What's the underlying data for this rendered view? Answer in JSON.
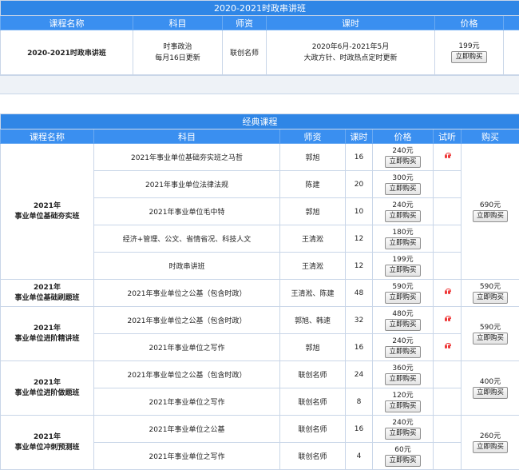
{
  "top": {
    "title": "2020-2021时政串讲班",
    "headers": [
      "课程名称",
      "科目",
      "师资",
      "课时",
      "价格"
    ],
    "row": {
      "name": "2020-2021时政串讲班",
      "subject_line1": "时事政治",
      "subject_line2": "每月16日更新",
      "teacher": "联创名师",
      "hours_line1": "2020年6月-2021年5月",
      "hours_line2": "大政方针、时政热点定时更新",
      "price": "199元",
      "buy": "立即购买"
    }
  },
  "classic": {
    "title": "经典课程",
    "headers": [
      "课程名称",
      "科目",
      "师资",
      "课时",
      "价格",
      "试听",
      "购买"
    ],
    "buy_label": "立即购买",
    "groups": [
      {
        "name_line1": "2021年",
        "name_line2": "事业单位基础夯实班",
        "package_price": "690元",
        "rows": [
          {
            "subject": "2021年事业单位基础夯实班之马哲",
            "teacher": "郭旭",
            "hours": "16",
            "price": "240元"
          },
          {
            "subject": "2021年事业单位法律法规",
            "teacher": "陈建",
            "hours": "20",
            "price": "300元"
          },
          {
            "subject": "2021年事业单位毛中特",
            "teacher": "郭旭",
            "hours": "10",
            "price": "240元"
          },
          {
            "subject": "经济+管理、公文、省情省况、科技人文",
            "teacher": "王清淞",
            "hours": "12",
            "price": "180元"
          },
          {
            "subject": "时政串讲班",
            "teacher": "王清淞",
            "hours": "12",
            "price": "199元"
          }
        ]
      },
      {
        "name_line1": "2021年",
        "name_line2": "事业单位基础刷题班",
        "package_price": "590元",
        "rows": [
          {
            "subject": "2021年事业单位之公基（包含时政）",
            "teacher": "王清淞、陈建",
            "hours": "48",
            "price": "590元"
          }
        ]
      },
      {
        "name_line1": "2021年",
        "name_line2": "事业单位进阶精讲班",
        "package_price": "590元",
        "rows": [
          {
            "subject": "2021年事业单位之公基（包含时政）",
            "teacher": "郭旭、韩速",
            "hours": "32",
            "price": "480元"
          },
          {
            "subject": "2021年事业单位之写作",
            "teacher": "郭旭",
            "hours": "16",
            "price": "240元"
          }
        ]
      },
      {
        "name_line1": "2021年",
        "name_line2": "事业单位进阶做题班",
        "package_price": "400元",
        "rows": [
          {
            "subject": "2021年事业单位之公基（包含时政）",
            "teacher": "联创名师",
            "hours": "24",
            "price": "360元"
          },
          {
            "subject": "2021年事业单位之写作",
            "teacher": "联创名师",
            "hours": "8",
            "price": "120元"
          }
        ]
      },
      {
        "name_line1": "2021年",
        "name_line2": "事业单位冲刺预测班",
        "package_price": "260元",
        "rows": [
          {
            "subject": "2021年事业单位之公基",
            "teacher": "联创名师",
            "hours": "16",
            "price": "240元"
          },
          {
            "subject": "2021年事业单位之写作",
            "teacher": "联创名师",
            "hours": "4",
            "price": "60元"
          }
        ]
      }
    ],
    "trial_rows": [
      0,
      5,
      6,
      7
    ]
  },
  "colors": {
    "header_bar": "#2f86e6",
    "header_cells": "#3a8ff0",
    "border": "#c9d6e8",
    "trial_icon": "#e33333"
  }
}
